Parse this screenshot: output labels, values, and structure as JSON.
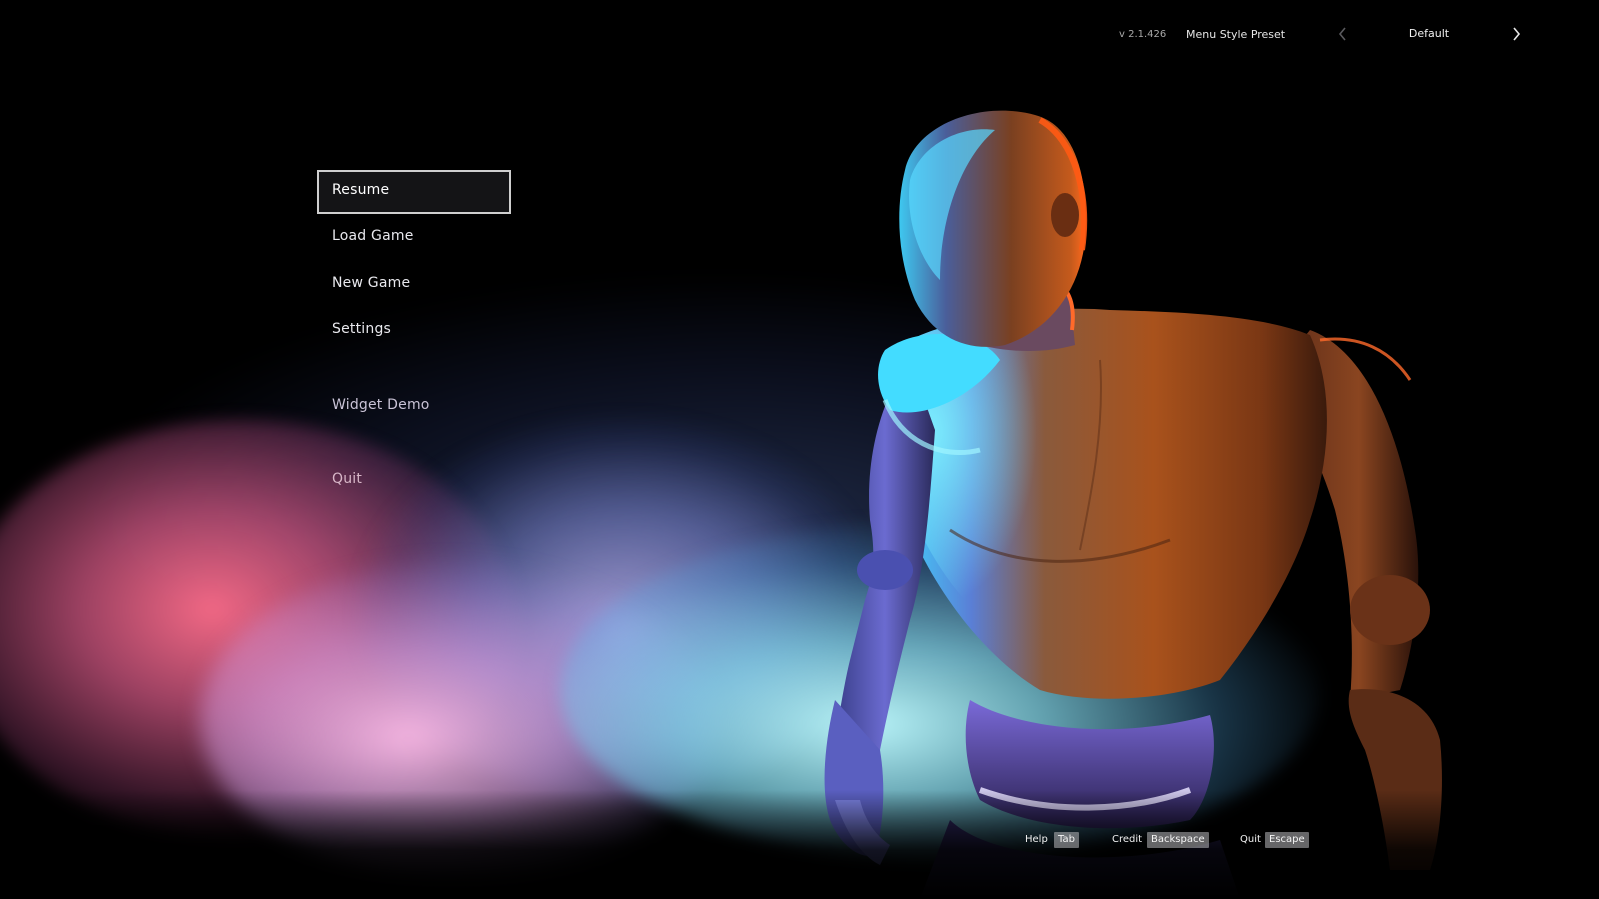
{
  "header": {
    "version": "v 2.1.426",
    "preset_label": "Menu Style Preset",
    "preset_value": "Default",
    "prev_icon": "chevron-left-icon",
    "next_icon": "chevron-right-icon"
  },
  "menu": {
    "items": [
      {
        "label": "Resume",
        "selected": true
      },
      {
        "label": "Load Game"
      },
      {
        "label": "New Game"
      },
      {
        "label": "Settings"
      },
      {
        "label": "Widget Demo"
      },
      {
        "label": "Quit"
      }
    ]
  },
  "hints": [
    {
      "label": "Help",
      "key": "Tab"
    },
    {
      "label": "Credit",
      "key": "Backspace"
    },
    {
      "label": "Quit",
      "key": "Escape"
    }
  ],
  "colors": {
    "selection_border": "#cfcfcf",
    "key_bg": "#b9b9be",
    "glow_red": "#ff6e8c",
    "glow_cyan": "#bef9ff",
    "figure_orange": "#b5581f"
  }
}
